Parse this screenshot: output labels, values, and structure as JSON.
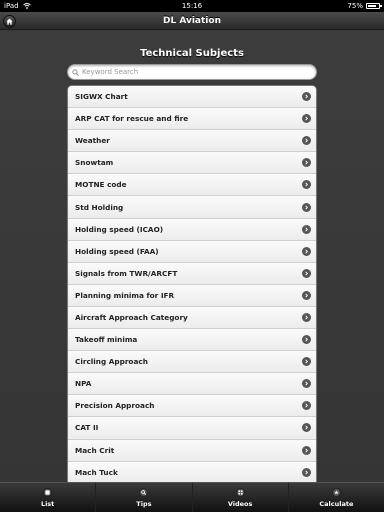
{
  "status_bar": {
    "device": "iPad",
    "time": "15:16",
    "battery_percent_label": "75%",
    "battery_level": 0.75
  },
  "header": {
    "title": "DL Aviation",
    "home_icon": "home-icon"
  },
  "main": {
    "section_title": "Technical Subjects",
    "search": {
      "placeholder": "Keyword Search",
      "value": ""
    },
    "items": [
      {
        "label": "SIGWX Chart"
      },
      {
        "label": "ARP CAT for rescue and fire"
      },
      {
        "label": "Weather"
      },
      {
        "label": "Snowtam"
      },
      {
        "label": "MOTNE code"
      },
      {
        "label": "Std Holding"
      },
      {
        "label": "Holding speed (ICAO)"
      },
      {
        "label": "Holding speed (FAA)"
      },
      {
        "label": "Signals from TWR/ARCFT"
      },
      {
        "label": "Planning minima for IFR"
      },
      {
        "label": "Aircraft Approach Category"
      },
      {
        "label": "Takeoff minima"
      },
      {
        "label": "Circling Approach"
      },
      {
        "label": "NPA"
      },
      {
        "label": "Precision Approach"
      },
      {
        "label": "CAT II"
      },
      {
        "label": "Mach Crit"
      },
      {
        "label": "Mach Tuck"
      }
    ]
  },
  "tab_bar": {
    "tabs": [
      {
        "label": "List",
        "icon": "list-icon"
      },
      {
        "label": "Tips",
        "icon": "search-icon"
      },
      {
        "label": "Videos",
        "icon": "grid-icon"
      },
      {
        "label": "Calculate",
        "icon": "star-icon"
      }
    ]
  },
  "colors": {
    "background": "#3a3a3a",
    "status_bar": "#000000",
    "list_item": "#f5f5f5",
    "item_text": "#222222",
    "chevron": "#555555"
  }
}
